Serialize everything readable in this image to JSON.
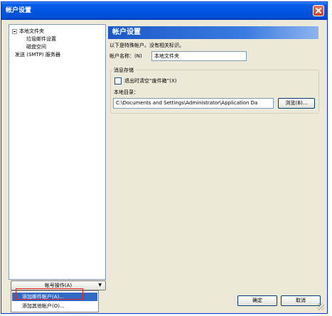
{
  "window": {
    "title": "帐户设置"
  },
  "tree": {
    "items": [
      {
        "label": "本地文件夹"
      },
      {
        "label": "垃圾邮件设置"
      },
      {
        "label": "磁盘空间"
      },
      {
        "label": "发送 (SMTP) 服务器"
      }
    ]
  },
  "account_actions": {
    "label": "帐号操作(A)",
    "menu": [
      {
        "label": "添加邮件帐户(A)..."
      },
      {
        "label": "添加其他帐户(O)..."
      }
    ]
  },
  "settings": {
    "title": "帐户设置",
    "description": "以下是特殊帐户。没有相关标识。",
    "account_name_label": "帐户名称：(N)",
    "account_name_value": "本地文件夹",
    "message_storage": {
      "group_label": "消息存储",
      "empty_trash_label": "退出时清空“废件箱”(X)",
      "empty_trash_checked": false,
      "local_dir_label": "本地目录：",
      "local_dir_value": "C:\\Documents and Settings\\Administrator\\Application Da",
      "browse_label": "浏览(B)..."
    }
  },
  "buttons": {
    "ok": "确定",
    "cancel": "取消"
  }
}
